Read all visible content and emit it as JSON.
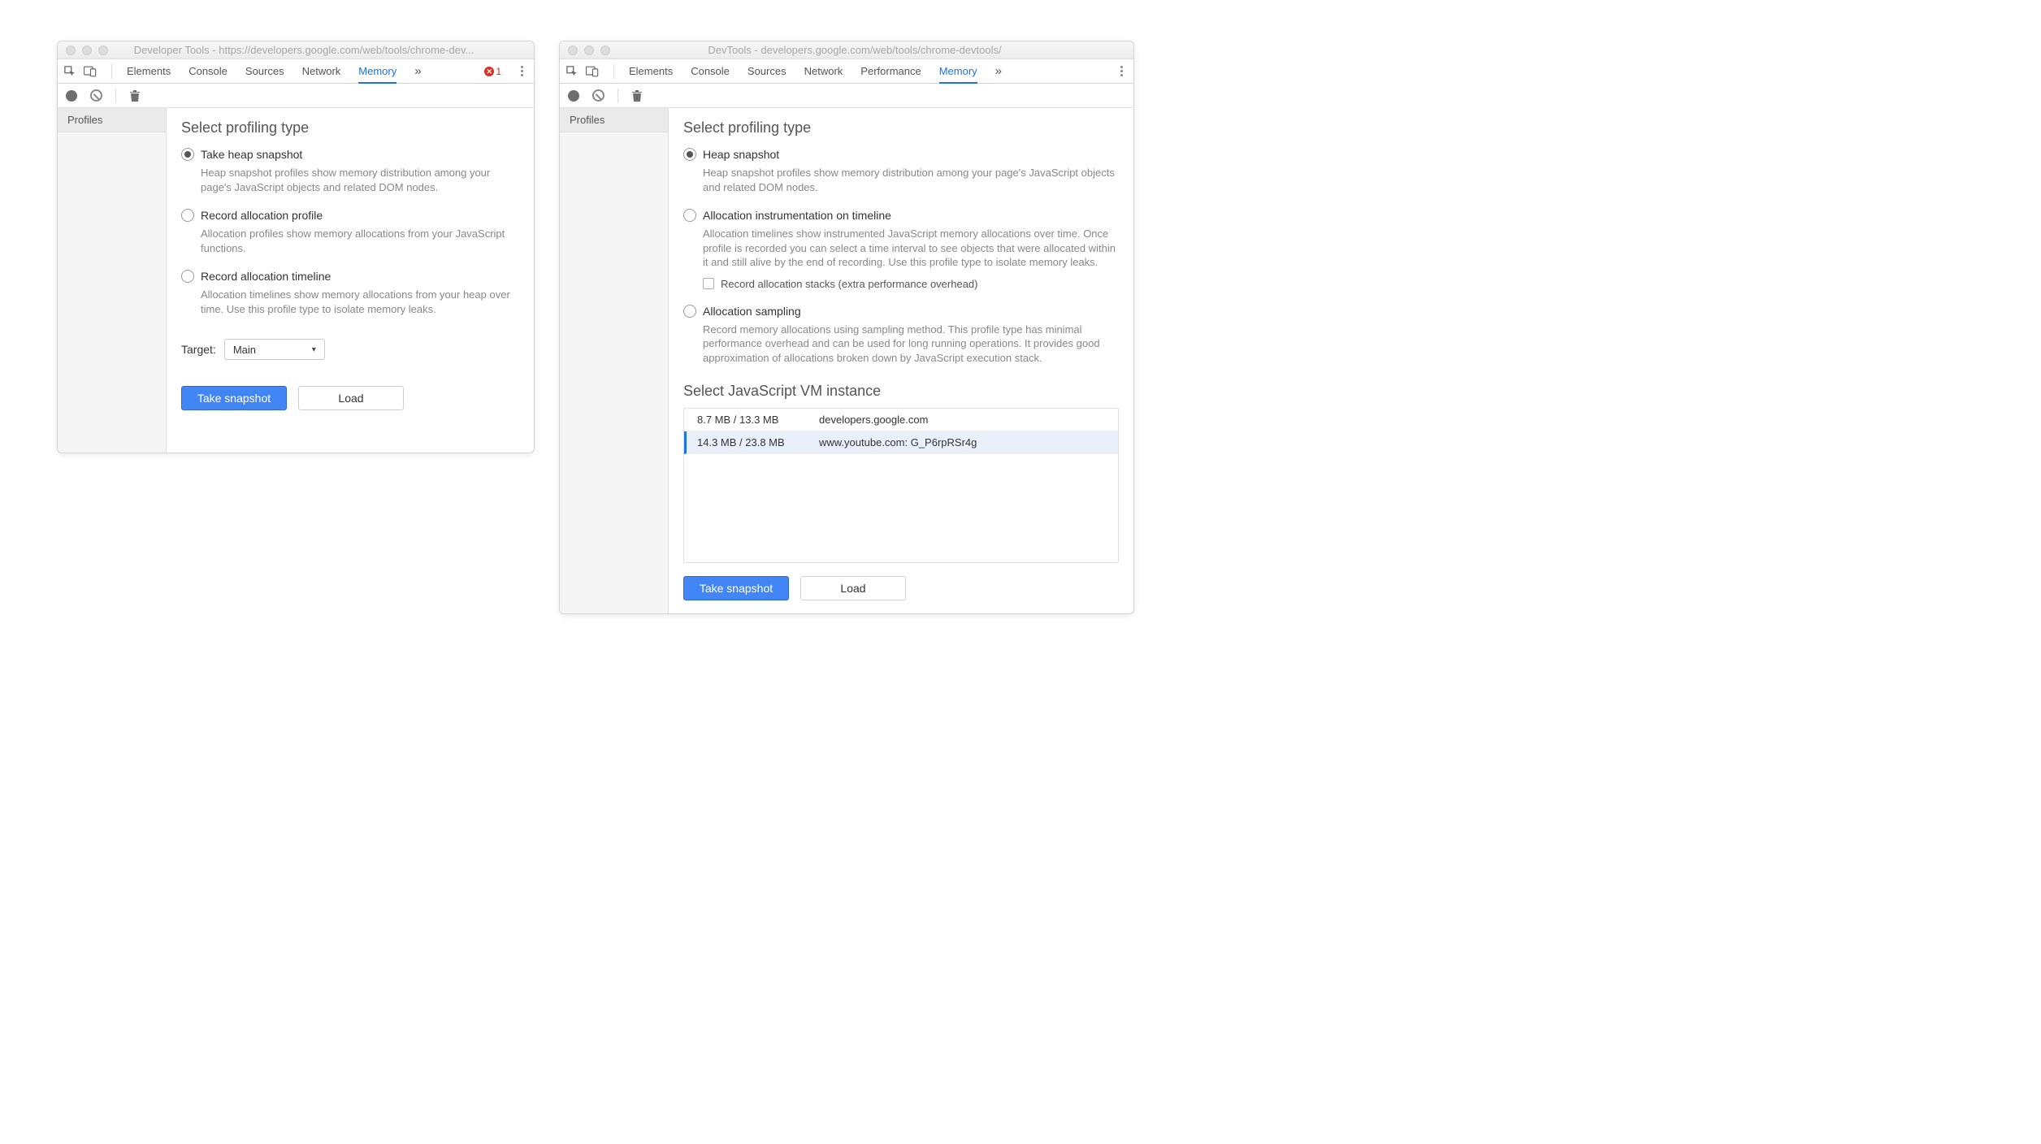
{
  "left": {
    "window_title": "Developer Tools - https://developers.google.com/web/tools/chrome-dev...",
    "tabs": [
      "Elements",
      "Console",
      "Sources",
      "Network",
      "Memory"
    ],
    "active_tab": "Memory",
    "error_count": "1",
    "sidebar": {
      "item": "Profiles"
    },
    "heading": "Select profiling type",
    "options": [
      {
        "title": "Take heap snapshot",
        "desc": "Heap snapshot profiles show memory distribution among your page's JavaScript objects and related DOM nodes.",
        "checked": true
      },
      {
        "title": "Record allocation profile",
        "desc": "Allocation profiles show memory allocations from your JavaScript functions.",
        "checked": false
      },
      {
        "title": "Record allocation timeline",
        "desc": "Allocation timelines show memory allocations from your heap over time. Use this profile type to isolate memory leaks.",
        "checked": false
      }
    ],
    "target_label": "Target:",
    "target_value": "Main",
    "buttons": {
      "primary": "Take snapshot",
      "secondary": "Load"
    }
  },
  "right": {
    "window_title": "DevTools - developers.google.com/web/tools/chrome-devtools/",
    "tabs": [
      "Elements",
      "Console",
      "Sources",
      "Network",
      "Performance",
      "Memory"
    ],
    "active_tab": "Memory",
    "sidebar": {
      "item": "Profiles"
    },
    "heading": "Select profiling type",
    "options": [
      {
        "title": "Heap snapshot",
        "desc": "Heap snapshot profiles show memory distribution among your page's JavaScript objects and related DOM nodes.",
        "checked": true
      },
      {
        "title": "Allocation instrumentation on timeline",
        "desc": "Allocation timelines show instrumented JavaScript memory allocations over time. Once profile is recorded you can select a time interval to see objects that were allocated within it and still alive by the end of recording. Use this profile type to isolate memory leaks.",
        "checked": false,
        "sub": "Record allocation stacks (extra performance overhead)"
      },
      {
        "title": "Allocation sampling",
        "desc": "Record memory allocations using sampling method. This profile type has minimal performance overhead and can be used for long running operations. It provides good approximation of allocations broken down by JavaScript execution stack.",
        "checked": false
      }
    ],
    "vm_heading": "Select JavaScript VM instance",
    "vm_instances": [
      {
        "size": "8.7 MB / 13.3 MB",
        "name": "developers.google.com",
        "selected": false
      },
      {
        "size": "14.3 MB / 23.8 MB",
        "name": "www.youtube.com: G_P6rpRSr4g",
        "selected": true
      }
    ],
    "buttons": {
      "primary": "Take snapshot",
      "secondary": "Load"
    }
  },
  "colors": {
    "accent": "#4285f4",
    "active_tab": "#1a73e8",
    "error": "#d93025"
  }
}
